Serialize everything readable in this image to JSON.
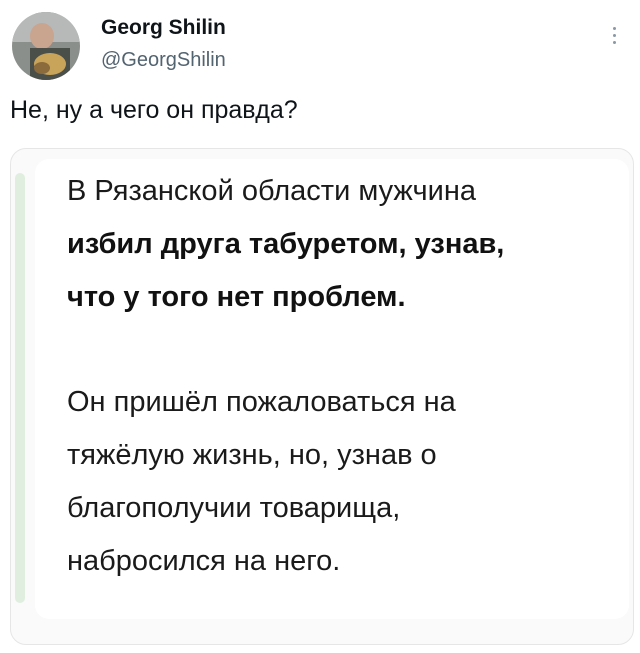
{
  "tweet": {
    "author": {
      "display_name": "Georg Shilin",
      "handle": "@GeorgShilin"
    },
    "text": "Не, ну а чего он правда?",
    "more_icon": "more-vertical-icon",
    "media": {
      "paragraph_1": [
        "В Рязанской области мужчина",
        "избил друга табуретом, узнав,",
        "что у того нет проблем."
      ],
      "paragraph_1_bold_lines": [
        1,
        2
      ],
      "paragraph_2": [
        "Он пришёл пожаловаться на",
        "тяжёлую жизнь, но, узнав о",
        "благополучии товарища,",
        "набросился на него."
      ]
    }
  },
  "colors": {
    "text_primary": "#0f1419",
    "text_secondary": "#536471",
    "accent_bar": "#dfeede"
  }
}
